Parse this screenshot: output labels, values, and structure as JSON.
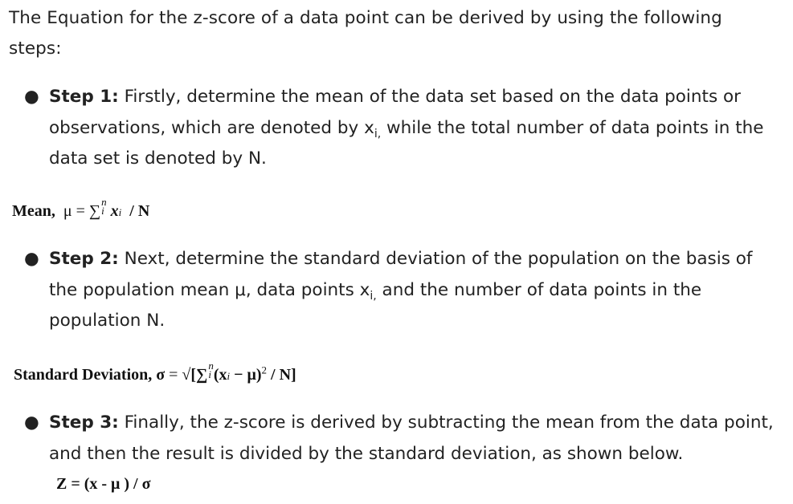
{
  "intro": "The Equation for the z-score of a data point can be derived by using the following steps:",
  "steps": [
    {
      "label": "Step 1:",
      "text_before_sub": " Firstly, determine the mean of the data set based on the data points or observations, which are denoted by x",
      "sub": "i,",
      "text_after_sub": " while the total number of data points in the data set is denoted by N."
    },
    {
      "label": "Step 2:",
      "text_before_sub": " Next, determine the standard deviation of the population on the basis of the population mean μ, data points x",
      "sub": "i,",
      "text_after_sub": " and the number of data points in the population N."
    },
    {
      "label": "Step 3:",
      "text": " Finally, the z-score is derived by subtracting the mean from the data point, and then the result is divided by the standard deviation, as shown below."
    }
  ],
  "formulas": {
    "mean": {
      "label": "Mean,",
      "lhs": "μ =",
      "sigma": "∑",
      "upper": "n",
      "lower": "i",
      "var": "x",
      "var_sub": "i",
      "rest": "/ N"
    },
    "std_dev": {
      "label": "Standard Deviation,",
      "lhs": "σ",
      "eq": "=",
      "open": "√[∑",
      "upper": "n",
      "lower": "i",
      "inner": "(x",
      "inner_sub": "i",
      "minus_mu": " − μ)",
      "power": "2",
      "rest": " / N]"
    },
    "zscore": {
      "text": "Z = (x -  μ ) / σ"
    }
  }
}
